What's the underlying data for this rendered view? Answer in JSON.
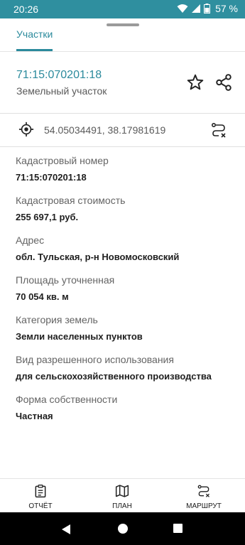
{
  "status_bar": {
    "time": "20:26",
    "battery": "57 %",
    "icons": [
      "wifi-icon",
      "signal-icon",
      "battery-icon"
    ]
  },
  "tabs": [
    {
      "label": "Участки",
      "active": true
    }
  ],
  "parcel": {
    "number": "71:15:070201:18",
    "type": "Земельный участок"
  },
  "coordinates": "54.05034491, 38.17981619",
  "fields": [
    {
      "label": "Кадастровый номер",
      "value": "71:15:070201:18"
    },
    {
      "label": "Кадастровая стоимость",
      "value": "255 697,1 руб."
    },
    {
      "label": "Адрес",
      "value": "обл. Тульская, р-н Новомосковский"
    },
    {
      "label": "Площадь уточненная",
      "value": "70 054 кв. м"
    },
    {
      "label": "Категория земель",
      "value": "Земли населенных пунктов"
    },
    {
      "label": "Вид разрешенного использования",
      "value": "для сельскохозяйственного производства"
    },
    {
      "label": "Форма собственности",
      "value": "Частная"
    }
  ],
  "bottom_nav": [
    {
      "label": "ОТЧЁТ",
      "icon": "report-icon"
    },
    {
      "label": "ПЛАН",
      "icon": "map-icon"
    },
    {
      "label": "МАРШРУТ",
      "icon": "route-icon"
    }
  ],
  "colors": {
    "accent": "#2b8a9c",
    "status_bar": "#2f8f9f"
  }
}
